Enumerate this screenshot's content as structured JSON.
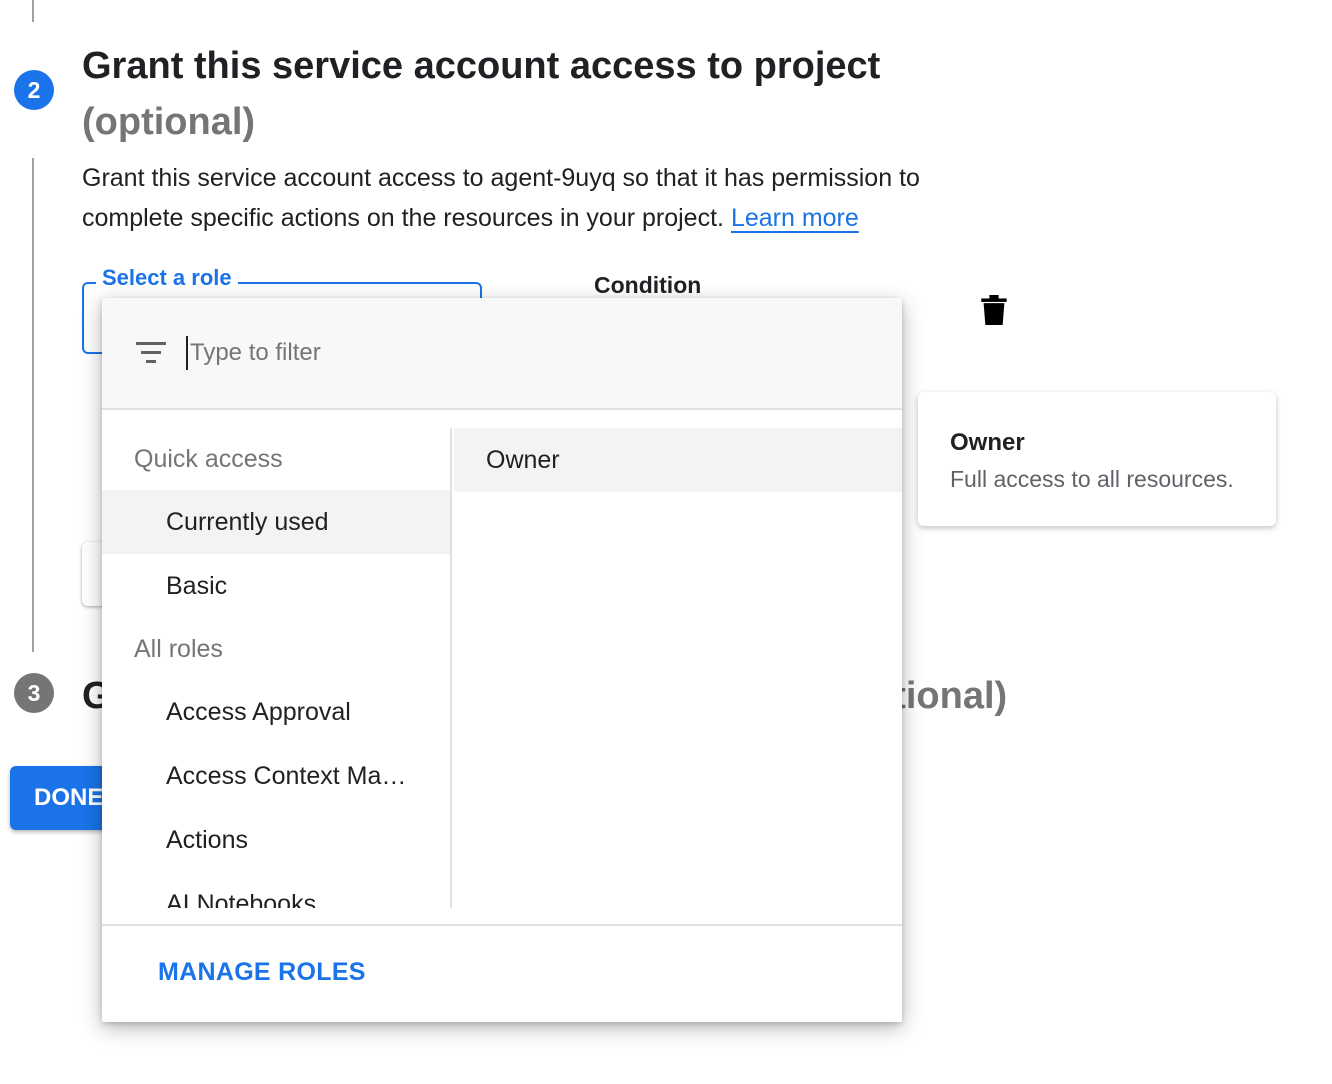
{
  "step2": {
    "number": "2",
    "title": "Grant this service account access to project",
    "optional": "(optional)",
    "description": "Grant this service account access to agent-9uyq so that it has permission to complete specific actions on the resources in your project.",
    "learn_more": "Learn more"
  },
  "role_field": {
    "label": "Select a role"
  },
  "condition": {
    "label": "Condition"
  },
  "step3": {
    "number": "3",
    "title_visible_start": "G",
    "optional_visible_end": "otional)"
  },
  "done_button": {
    "label": "DONE"
  },
  "dropdown": {
    "filter_placeholder": "Type to filter",
    "groups": [
      {
        "header": "Quick access",
        "items": [
          {
            "label": "Currently used",
            "selected": true
          },
          {
            "label": "Basic",
            "selected": false
          }
        ]
      },
      {
        "header": "All roles",
        "items": [
          {
            "label": "Access Approval",
            "selected": false
          },
          {
            "label": "Access Context Ma…",
            "selected": false
          },
          {
            "label": "Actions",
            "selected": false
          },
          {
            "label": "AI Notebooks",
            "selected": false
          }
        ]
      }
    ],
    "roles": [
      {
        "label": "Owner",
        "highlighted": true
      }
    ],
    "manage_roles": "MANAGE ROLES"
  },
  "tooltip": {
    "title": "Owner",
    "description": "Full access to all resources."
  },
  "colors": {
    "accent": "#1a73e8",
    "muted": "#757575"
  },
  "icons": {
    "filter": "filter-list-icon",
    "delete": "trash-icon"
  }
}
